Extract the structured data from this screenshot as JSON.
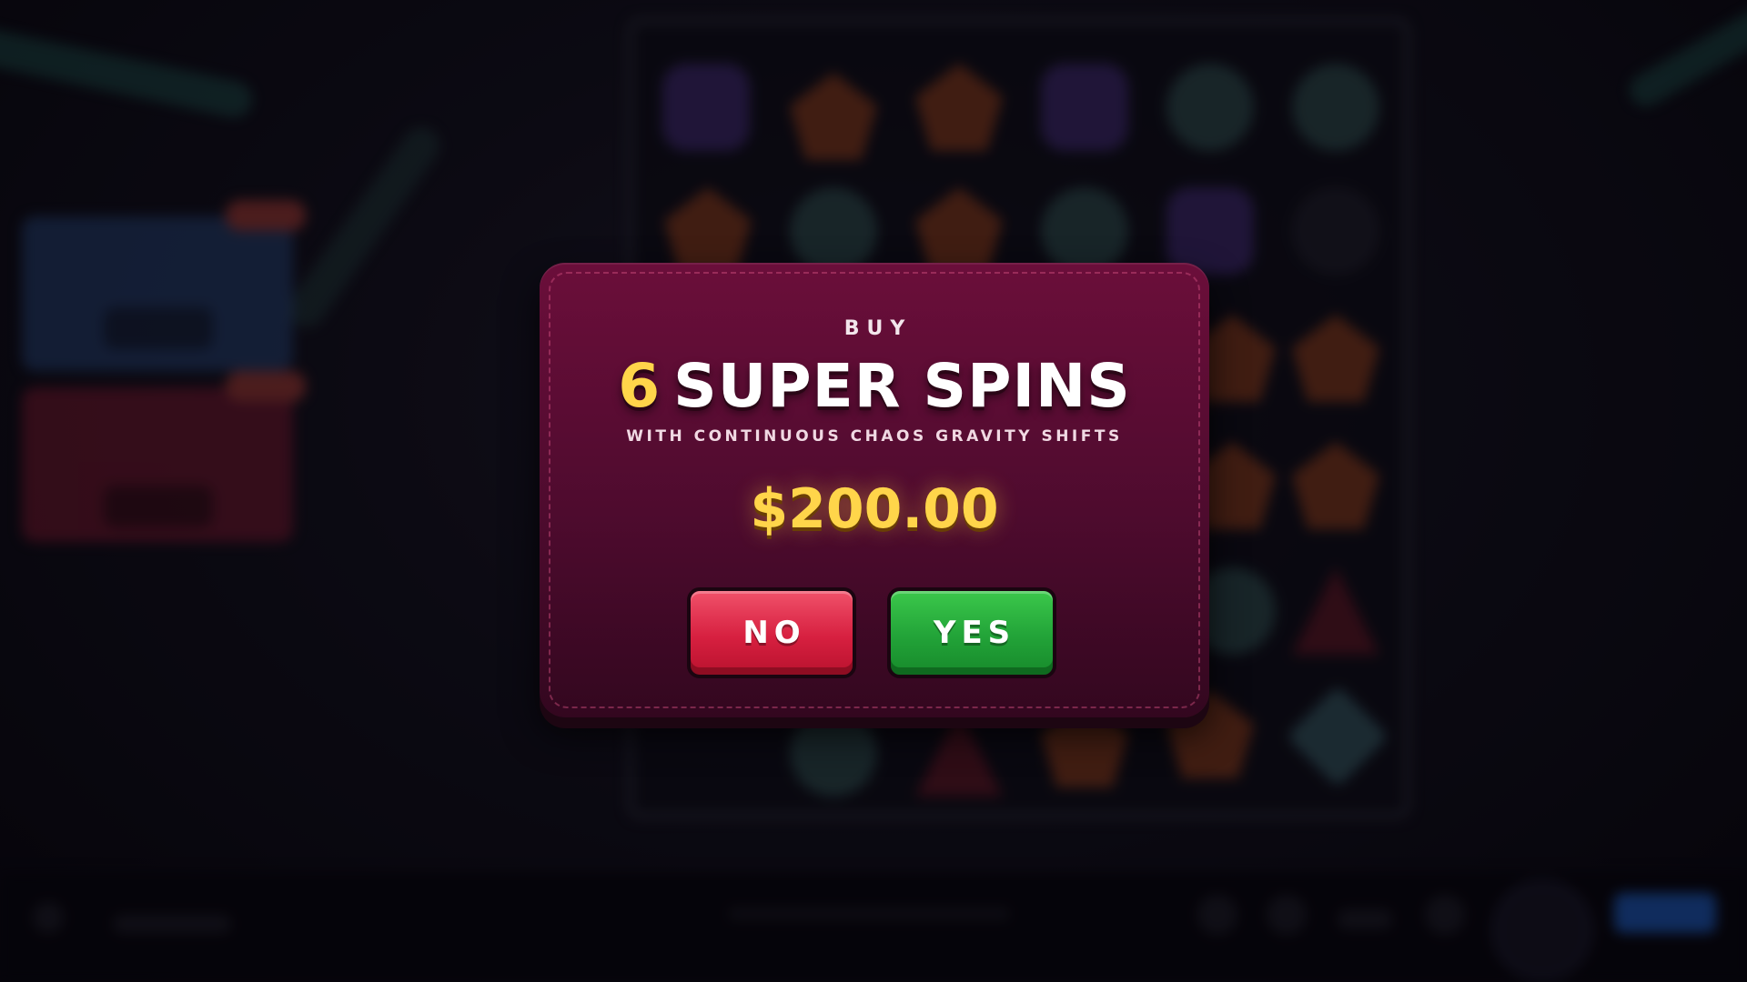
{
  "dialog": {
    "buy_label": "BUY",
    "spin_count": "6",
    "title": "SUPER SPINS",
    "subtitle": "WITH CONTINUOUS CHAOS GRAVITY SHIFTS",
    "price": "$200.00",
    "no_label": "NO",
    "yes_label": "YES"
  },
  "colors": {
    "dialog_bg": "#5a0c33",
    "accent_gold": "#ffd54a",
    "no_button": "#d72040",
    "yes_button": "#22a338"
  },
  "background_symbols": [
    "purple-alien-icon",
    "orange-pentagon-icon",
    "teal-orb-icon",
    "dark-bomb-icon",
    "red-triangle-icon",
    "cyan-diamond-icon"
  ]
}
